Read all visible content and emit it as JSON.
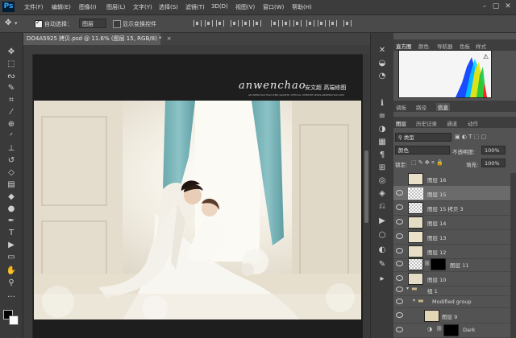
{
  "app": {
    "logo": "Ps"
  },
  "menu": [
    "文件(F)",
    "编辑(E)",
    "图像(I)",
    "图层(L)",
    "文字(Y)",
    "选择(S)",
    "滤镜(T)",
    "3D(D)",
    "视图(V)",
    "窗口(W)",
    "帮助(H)"
  ],
  "options": {
    "auto_select_label": "自动选择：",
    "auto_select_value": "图层",
    "show_transform_label": "显示变换控件"
  },
  "document": {
    "tab_title": "DO4A5925 拷贝.psd @ 11.6% (图层 15, RGB/8) *",
    "watermark_main": "anwenchao",
    "watermark_cn": "安文超 高端修图",
    "watermark_sub": "AN WENCHAO HIGH-END GRAPHIC OFFICIAL WEBSITE:WWW.ANWENCHAO.COM"
  },
  "panels": {
    "top_tabs": [
      "直方图",
      "颜色",
      "导航器",
      "色板",
      "样式"
    ],
    "mid_tabs": [
      "调板",
      "路径",
      "信息"
    ],
    "layer_tabs": [
      "图层",
      "历史记录",
      "通道",
      "动作"
    ],
    "filter_kind": "类型",
    "blend_mode": "颜色",
    "opacity_label": "不透明度:",
    "opacity_value": "100%",
    "lock_label": "锁定:",
    "fill_label": "填充:",
    "fill_value": "100%"
  },
  "layers": [
    {
      "name": "图层 16",
      "selected": false
    },
    {
      "name": "图层 15",
      "selected": true
    },
    {
      "name": "图层 15 拷贝 3",
      "selected": false
    },
    {
      "name": "图层 14",
      "selected": false
    },
    {
      "name": "图层 13",
      "selected": false
    },
    {
      "name": "图层 12",
      "selected": false
    },
    {
      "name": "图层 11",
      "selected": false
    },
    {
      "name": "图层 10",
      "selected": false
    },
    {
      "name": "组 1",
      "selected": false
    },
    {
      "name": "Modified group",
      "selected": false
    },
    {
      "name": "图层 9",
      "selected": false
    },
    {
      "name": "Dark",
      "selected": false
    }
  ]
}
